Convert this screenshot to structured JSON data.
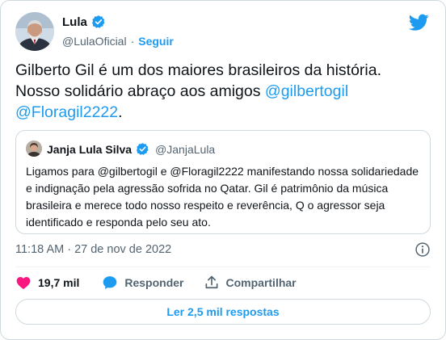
{
  "author": {
    "name": "Lula",
    "handle": "@LulaOficial",
    "follow_label": "Seguir"
  },
  "tweet": {
    "line1": "Gilberto Gil é um dos maiores brasileiros da história.",
    "line2_prefix": "Nosso solidário abraço aos amigos ",
    "mention1": "@gilbertogil",
    "mention2": "@Floragil2222",
    "suffix": "."
  },
  "quote": {
    "name": "Janja Lula Silva",
    "handle": "@JanjaLula",
    "text": "Ligamos para @gilbertogil e @Floragil2222 manifestando nossa solidariedade e indignação pela agressão sofrida no Qatar. Gil é patrimônio da música brasileira e merece todo nosso respeito e reverência, Q o agressor seja identificado e responda pelo seu ato."
  },
  "timestamp": "11:18 AM · 27 de nov de 2022",
  "actions": {
    "likes": "19,7 mil",
    "reply": "Responder",
    "share": "Compartilhar"
  },
  "read_replies": "Ler 2,5 mil respostas",
  "colors": {
    "accent": "#1d9bf0",
    "like": "#f91880",
    "text": "#0f1419",
    "muted": "#536471",
    "border": "#cfd9de"
  },
  "icons": [
    "verified-badge-icon",
    "twitter-bird-icon",
    "info-icon",
    "heart-icon",
    "reply-bubble-icon",
    "share-icon"
  ]
}
